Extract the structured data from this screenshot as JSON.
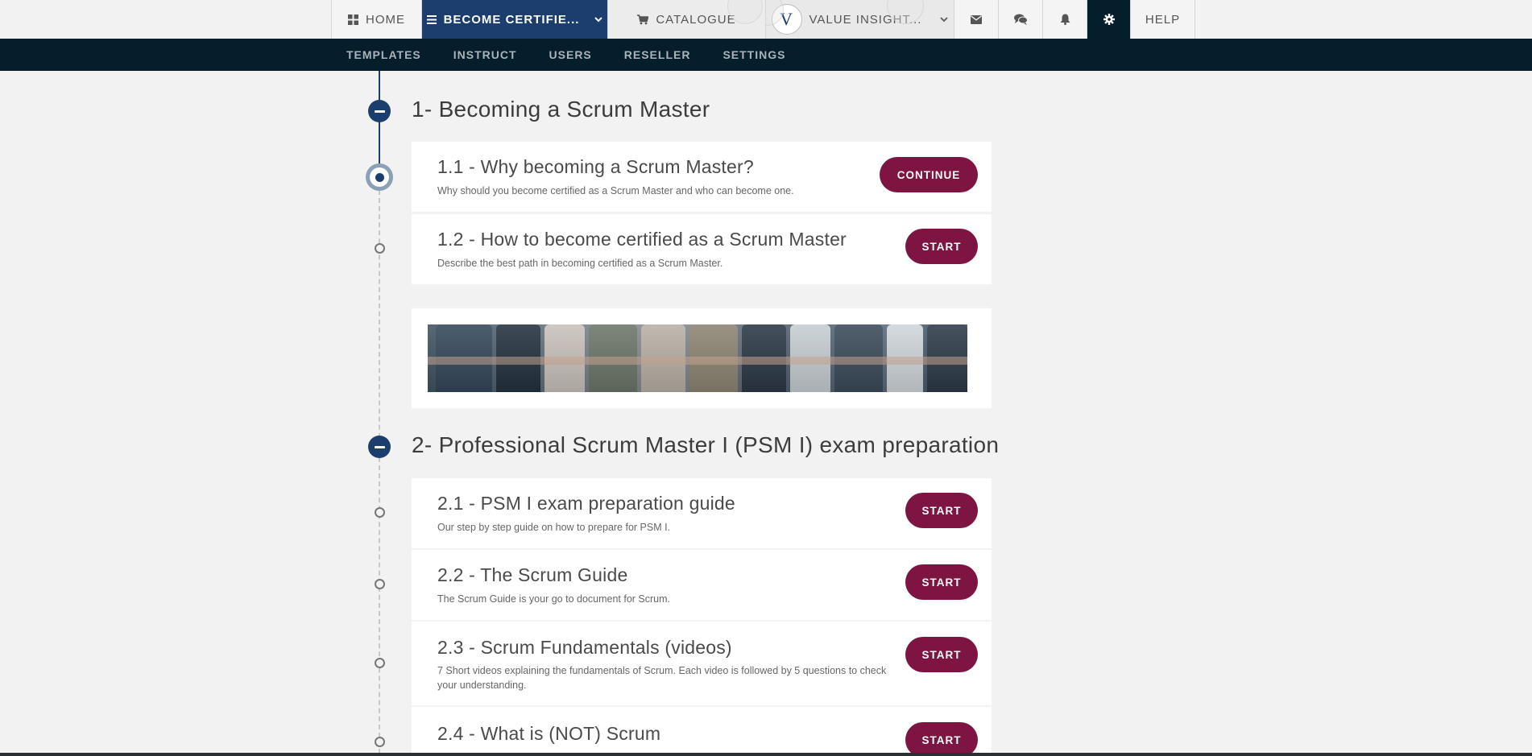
{
  "nav": {
    "home": "HOME",
    "become": "BECOME CERTIFIE...",
    "catalogue": "CATALOGUE",
    "value": "VALUE INSIGHT...",
    "logo_letter": "V",
    "help": "HELP"
  },
  "subnav": [
    "TEMPLATES",
    "INSTRUCT",
    "USERS",
    "RESELLER",
    "SETTINGS"
  ],
  "sections": [
    {
      "title": "1- Becoming a Scrum Master",
      "items": [
        {
          "title": "1.1 - Why becoming a Scrum Master?",
          "desc": "Why should you become certified as a Scrum Master and who can become one.",
          "button": "CONTINUE"
        },
        {
          "title": "1.2 - How to become certified as a Scrum Master",
          "desc": "Describe the best path in becoming certified as a Scrum Master.",
          "button": "START"
        }
      ]
    },
    {
      "title": "2- Professional Scrum Master I (PSM I) exam preparation",
      "items": [
        {
          "title": "2.1 - PSM I exam preparation guide",
          "desc": "Our step by step guide on how to prepare for PSM I.",
          "button": "START"
        },
        {
          "title": "2.2 - The Scrum Guide",
          "desc": "The Scrum Guide is your go to document for Scrum.",
          "button": "START"
        },
        {
          "title": "2.3 - Scrum Fundamentals (videos)",
          "desc": "7 Short videos explaining the fundamentals of Scrum. Each video is followed by 5 questions to check your understanding.",
          "button": "START"
        },
        {
          "title": "2.4 - What is (NOT) Scrum",
          "desc": "",
          "button": "START"
        }
      ]
    }
  ],
  "icons": {
    "home": "grid-icon",
    "become": "list-icon",
    "catalogue": "cart-icon",
    "mail": "envelope-icon",
    "chat": "chat-icon",
    "bell": "bell-icon",
    "gear": "gear-icon"
  },
  "colors": {
    "primary": "#1b3e6e",
    "dark": "#041e2b",
    "button": "#7d1442",
    "background": "#f2f2f2"
  }
}
